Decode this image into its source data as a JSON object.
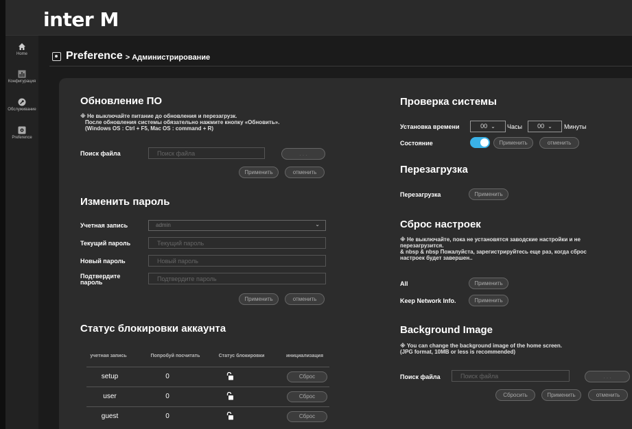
{
  "header": {
    "logo": "inter M"
  },
  "sidebar": {
    "items": [
      {
        "label": "Home"
      },
      {
        "label": "Конфигурация"
      },
      {
        "label": "Обслуживание"
      },
      {
        "label": "Preference"
      }
    ]
  },
  "page": {
    "title": "Preference",
    "breadcrumb": "> Администрирование"
  },
  "firmware": {
    "title": "Обновление ПО",
    "note_lines": [
      "※ Не выключайте питание до обновления и перезагрузк.",
      "После обновления системы обязательно нажмите кнопку «Обновить».",
      "(Windows OS : Ctrl + F5, Mac OS : command + R)"
    ],
    "file_label": "Поиск файла",
    "file_placeholder": "Поиск файла",
    "browse_label": ". . .",
    "apply": "Применить",
    "cancel": "отменить"
  },
  "password": {
    "title": "Изменить пароль",
    "account_label": "Учетная запись",
    "account_value": "admin",
    "current_label": "Текущий пароль",
    "current_placeholder": "Текущий пароль",
    "new_label": "Новый пароль",
    "new_placeholder": "Новый пароль",
    "confirm_label_1": "Подтвердите",
    "confirm_label_2": "пароль",
    "confirm_placeholder": "Подтвердите пароль",
    "apply": "Применить",
    "cancel": "отменить"
  },
  "lockout": {
    "title": "Статус блокировки аккаунта",
    "columns": [
      "учетная запись",
      "Попробуй посчитать",
      "Статус блокировки",
      "инициализация"
    ],
    "rows": [
      {
        "account": "setup",
        "attempts": "0",
        "reset": "Сброс"
      },
      {
        "account": "user",
        "attempts": "0",
        "reset": "Сброс"
      },
      {
        "account": "guest",
        "attempts": "0",
        "reset": "Сброс"
      }
    ]
  },
  "system_check": {
    "title": "Проверка системы",
    "time_label": "Установка времени",
    "hours_value": "00",
    "hours_unit": "Часы",
    "minutes_value": "00",
    "minutes_unit": "Минуты",
    "state_label": "Состояние",
    "state_on": true,
    "apply": "Применить",
    "cancel": "отменить"
  },
  "reboot": {
    "title": "Перезагрузка",
    "label": "Перезагрузка",
    "apply": "Применить"
  },
  "factory_reset": {
    "title": "Сброс настроек",
    "note_lines": [
      "※ Не выключайте, пока не установятся заводские настройки и не",
      "перезагрузится.",
      "& nbsp & nbsp Пожалуйста, зарегистрируйтесь еще раз, когда сброс",
      "настроек будет завершен.."
    ],
    "all_label": "All",
    "keep_label": "Keep Network Info.",
    "apply": "Применить"
  },
  "background": {
    "title": "Background Image",
    "note_lines": [
      "※ You can change the background image of the home screen.",
      "(JPG format, 10MB or less is recommended)"
    ],
    "file_label": "Поиск файла",
    "file_placeholder": "Поиск файла",
    "browse_label": ". . .",
    "reset": "Сбросить",
    "apply": "Применить",
    "cancel": "отменить"
  },
  "colors": {
    "accent": "#3ab2e8",
    "panel": "#2c2c2c",
    "background": "#1b1b1b"
  }
}
